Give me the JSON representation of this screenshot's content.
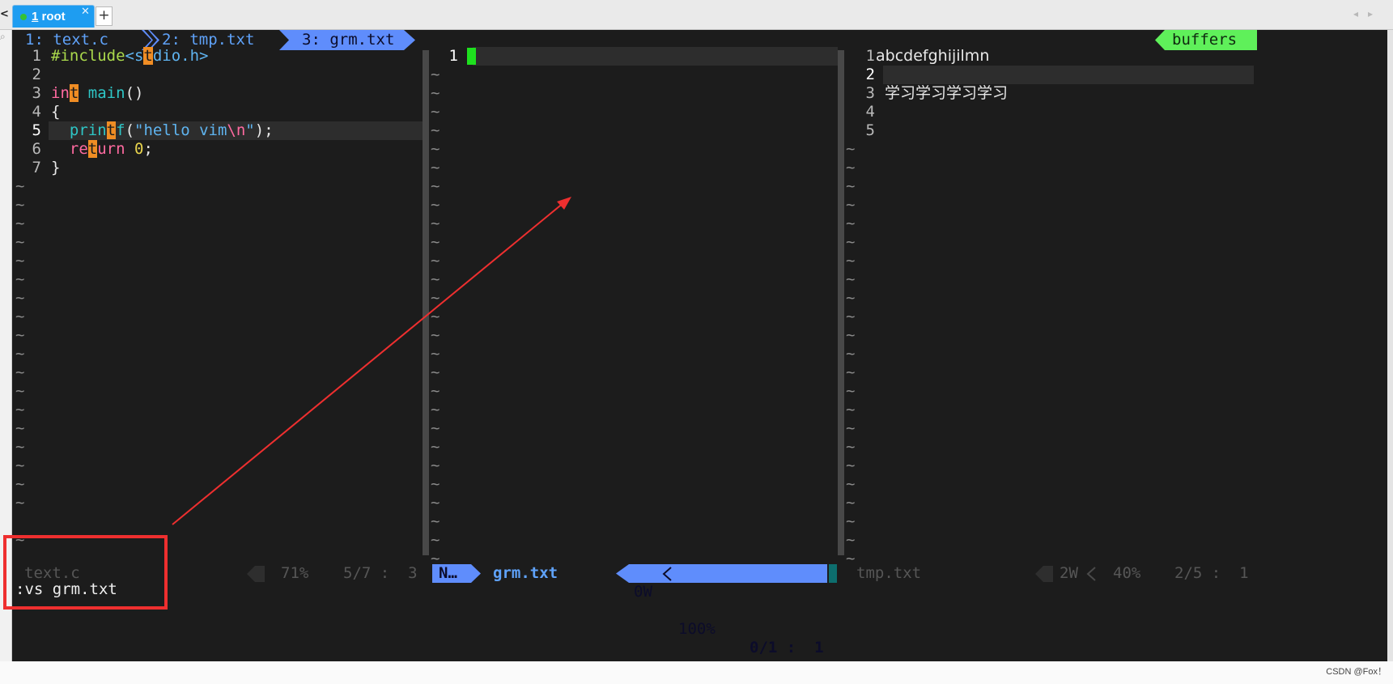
{
  "window_tabs": {
    "active": {
      "number": "1",
      "label": " root",
      "close": "✕"
    },
    "add": "+",
    "nav_prev": "◂",
    "nav_next": "▸",
    "left_edge_glyph": "<"
  },
  "tabline": {
    "items": [
      {
        "label": "1: text.c"
      },
      {
        "label": "2: tmp.txt"
      },
      {
        "label": "3: grm.txt"
      }
    ],
    "buffers_label": "buffers"
  },
  "pane_left": {
    "lines": [
      {
        "n": "1",
        "segments": [
          {
            "t": "#include",
            "c": "k-pre"
          },
          {
            "t": "<s",
            "c": "k-str"
          },
          {
            "t": "t",
            "c": "hl"
          },
          {
            "t": "dio.h>",
            "c": "k-str"
          }
        ]
      },
      {
        "n": "2",
        "segments": []
      },
      {
        "n": "3",
        "segments": [
          {
            "t": "in",
            "c": "k-kw"
          },
          {
            "t": "t",
            "c": "hl"
          },
          {
            "t": " ",
            "c": ""
          },
          {
            "t": "main",
            "c": "k-fn"
          },
          {
            "t": "()",
            "c": ""
          }
        ]
      },
      {
        "n": "4",
        "segments": [
          {
            "t": "{",
            "c": ""
          }
        ]
      },
      {
        "n": "5",
        "current": true,
        "segments": [
          {
            "t": "  ",
            "c": ""
          },
          {
            "t": "prin",
            "c": "k-fn"
          },
          {
            "t": "t",
            "c": "hl"
          },
          {
            "t": "f",
            "c": "k-fn"
          },
          {
            "t": "(",
            "c": ""
          },
          {
            "t": "\"hello vim",
            "c": "k-str"
          },
          {
            "t": "\\n",
            "c": "k-esc"
          },
          {
            "t": "\"",
            "c": "k-str"
          },
          {
            "t": ");",
            "c": ""
          }
        ]
      },
      {
        "n": "6",
        "segments": [
          {
            "t": "  ",
            "c": ""
          },
          {
            "t": "re",
            "c": "k-kw"
          },
          {
            "t": "t",
            "c": "hl"
          },
          {
            "t": "urn",
            "c": "k-kw"
          },
          {
            "t": " ",
            "c": ""
          },
          {
            "t": "0",
            "c": "k-num"
          },
          {
            "t": ";",
            "c": ""
          }
        ]
      },
      {
        "n": "7",
        "segments": [
          {
            "t": "}",
            "c": ""
          }
        ]
      }
    ],
    "tilde": "~"
  },
  "pane_middle": {
    "lines": [
      {
        "n": "1"
      }
    ],
    "tilde": "~"
  },
  "pane_right": {
    "lines": [
      {
        "n": "1",
        "text": "abcdefghijilmn"
      },
      {
        "n": "2",
        "text": "",
        "current": true
      },
      {
        "n": "3",
        "text": "学习学习学习学习"
      },
      {
        "n": "4",
        "text": ""
      },
      {
        "n": "5",
        "text": ""
      }
    ],
    "tilde": "~"
  },
  "statusline": {
    "left": {
      "file": "text.c",
      "percent": "71%",
      "position": "5/7 :  3"
    },
    "middle": {
      "mode": "N…",
      "file": "grm.txt",
      "warnings": "0W",
      "percent": "100%",
      "position": "0/1 :  1"
    },
    "right": {
      "file": "tmp.txt",
      "warnings": "2W",
      "percent": "40%",
      "position": "2/5 :  1"
    }
  },
  "command_line": ":vs grm.txt",
  "watermark": "CSDN @Fox！",
  "colors": {
    "tab_accent": "#5f8dfc",
    "buffers_badge": "#5ff05a",
    "annotation_red": "#ee2f2f",
    "cursor": "#1ee01e"
  }
}
